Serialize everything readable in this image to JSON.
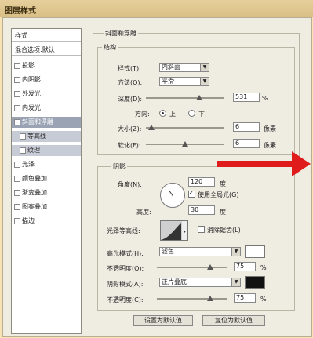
{
  "window": {
    "title": "图层样式"
  },
  "sidebar": {
    "header": "样式",
    "blend_item": "混合选项:默认",
    "items": [
      {
        "label": "投影"
      },
      {
        "label": "内阴影"
      },
      {
        "label": "外发光"
      },
      {
        "label": "内发光"
      },
      {
        "label": "斜面和浮雕",
        "selected": true
      },
      {
        "label": "等高线",
        "sub": true
      },
      {
        "label": "纹理",
        "sub": true
      },
      {
        "label": "光泽"
      },
      {
        "label": "颜色叠加"
      },
      {
        "label": "渐变叠加"
      },
      {
        "label": "图案叠加"
      },
      {
        "label": "描边"
      }
    ]
  },
  "bevel": {
    "group_title": "斜面和浮雕",
    "structure_title": "结构",
    "style_label": "样式(T):",
    "style_value": "内斜面",
    "technique_label": "方法(Q):",
    "technique_value": "平滑",
    "depth_label": "深度(D):",
    "depth_value": "531",
    "depth_unit": "%",
    "direction_label": "方向:",
    "dir_up": "上",
    "dir_down": "下",
    "size_label": "大小(Z):",
    "size_value": "6",
    "size_unit": "像素",
    "soften_label": "软化(F):",
    "soften_value": "6",
    "soften_unit": "像素"
  },
  "shading": {
    "title": "阴影",
    "angle_label": "角度(N):",
    "angle_value": "120",
    "angle_unit": "度",
    "global_light_label": "使用全局光(G)",
    "altitude_label": "高度:",
    "altitude_value": "30",
    "altitude_unit": "度",
    "gloss_label": "光泽等高线:",
    "antialias_label": "消除锯齿(L)",
    "highlight_mode_label": "高光模式(H):",
    "highlight_mode_value": "滤色",
    "highlight_opacity_label": "不透明度(O):",
    "highlight_opacity_value": "75",
    "shadow_mode_label": "阴影模式(A):",
    "shadow_mode_value": "正片叠底",
    "shadow_opacity_label": "不透明度(C):",
    "shadow_opacity_value": "75",
    "percent": "%"
  },
  "buttons": {
    "set_default": "设置为默认值",
    "reset_default": "复位为默认值"
  },
  "colors": {
    "arrow": "#e01b1b",
    "selected_item": "#9aa3b4"
  }
}
